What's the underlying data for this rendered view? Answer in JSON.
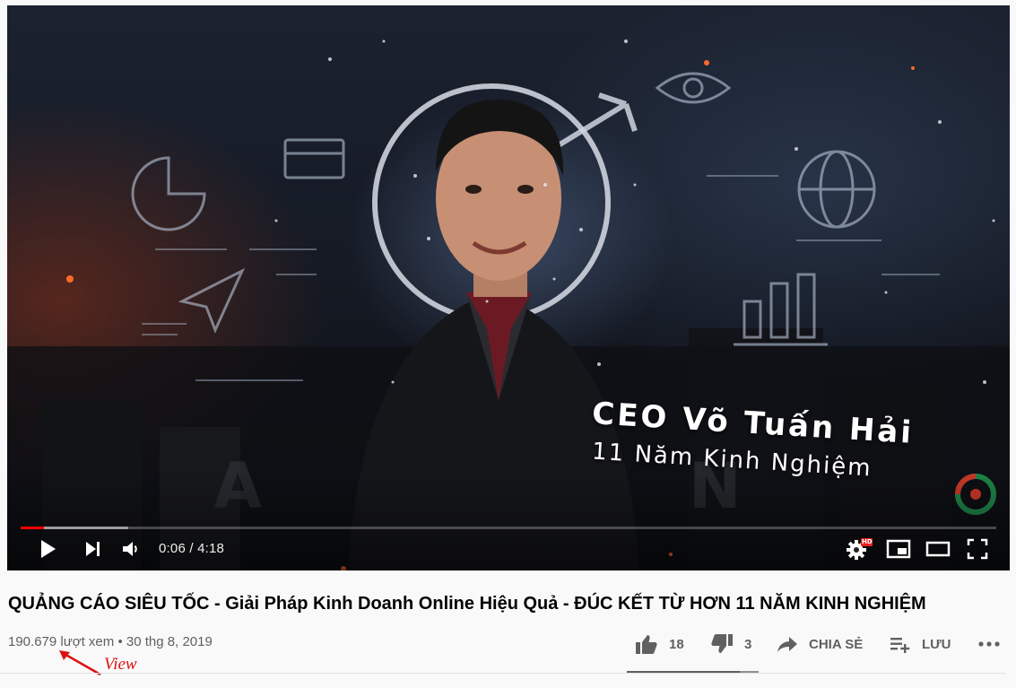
{
  "player": {
    "caption_name": "CEO Võ Tuấn Hải",
    "caption_experience": "11 Năm Kinh Nghiệm",
    "current_time": "0:06",
    "duration": "4:18",
    "time_display": "0:06 / 4:18",
    "progress_played": 0.024,
    "progress_loaded": 0.11,
    "settings_badge": "HD",
    "icons": [
      "play-icon",
      "next-icon",
      "volume-icon",
      "settings-icon",
      "miniplayer-icon",
      "theater-icon",
      "fullscreen-icon"
    ],
    "accent_color": "#ff0000"
  },
  "video": {
    "title": "QUẢNG CÁO SIÊU TỐC - Giải Pháp Kinh Doanh Online Hiệu Quả - ĐÚC KẾT TỪ HƠN 11 NĂM KINH NGHIỆM",
    "views": "190.679 lượt xem",
    "separator": "•",
    "date": "30 thg 8, 2019"
  },
  "actions": {
    "likes": "18",
    "dislikes": "3",
    "share_label": "CHIA SẺ",
    "save_label": "LƯU",
    "like_ratio": 0.857
  },
  "annotation": {
    "label": "View",
    "color": "#dd1111"
  }
}
